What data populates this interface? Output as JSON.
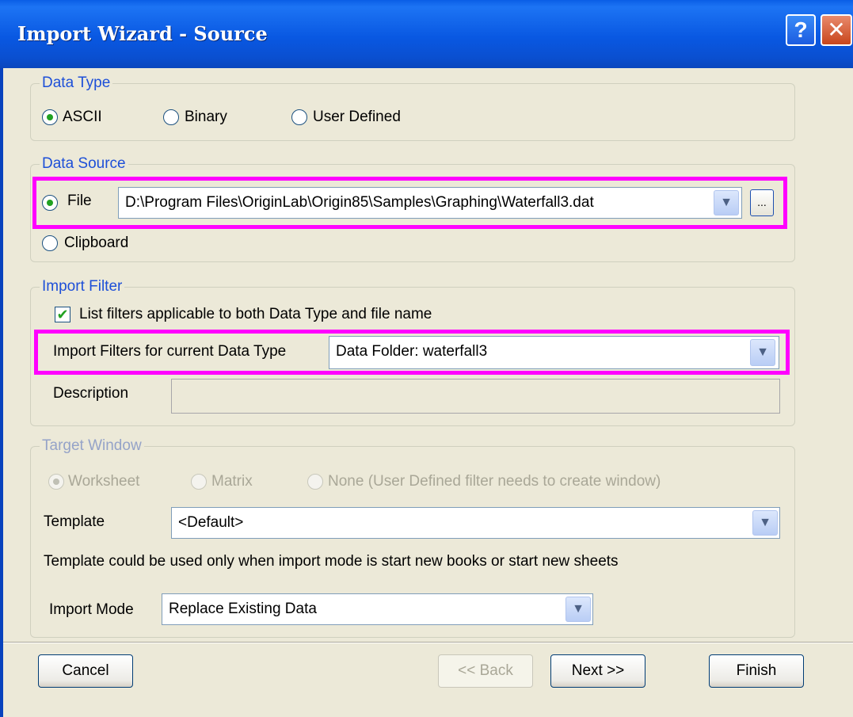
{
  "window": {
    "title": "Import Wizard - Source",
    "help_label": "?",
    "close_label": "✕"
  },
  "data_type": {
    "label": "Data Type",
    "options": [
      {
        "label": "ASCII",
        "checked": true
      },
      {
        "label": "Binary",
        "checked": false
      },
      {
        "label": "User Defined",
        "checked": false
      }
    ]
  },
  "data_source": {
    "label": "Data Source",
    "file_label": "File",
    "file_value": "D:\\Program Files\\OriginLab\\Origin85\\Samples\\Graphing\\Waterfall3.dat",
    "browse_label": "...",
    "clipboard_label": "Clipboard"
  },
  "import_filter": {
    "label": "Import Filter",
    "checkbox_label": "List filters applicable to both Data Type and file name",
    "checkbox_checked": true,
    "filters_label": "Import Filters for current Data Type",
    "filters_value": "Data Folder: waterfall3",
    "description_label": "Description",
    "description_value": ""
  },
  "target_window": {
    "label": "Target Window",
    "options": [
      {
        "label": "Worksheet",
        "checked": true
      },
      {
        "label": "Matrix",
        "checked": false
      },
      {
        "label": "None (User Defined filter needs to create window)",
        "checked": false
      }
    ],
    "template_label": "Template",
    "template_value": "<Default>",
    "template_note": "Template could be used only when import mode is start new books or start new sheets",
    "import_mode_label": "Import Mode",
    "import_mode_value": "Replace Existing Data"
  },
  "footer": {
    "cancel": "Cancel",
    "back": "<< Back",
    "next": "Next >>",
    "finish": "Finish"
  },
  "colors": {
    "highlight": "#ff00ff",
    "group_label": "#1d4fd8",
    "title_bar": "#0958e2"
  },
  "icons": {
    "dropdown": "chevron-down-icon",
    "check": "checkmark-icon"
  }
}
